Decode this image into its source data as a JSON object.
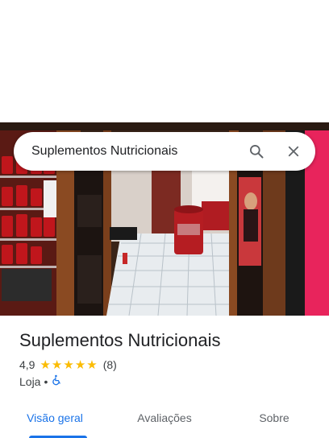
{
  "search": {
    "query": "Suplementos Nutricionais",
    "search_icon": "search-icon",
    "close_icon": "close-icon"
  },
  "place": {
    "name": "Suplementos Nutricionais",
    "rating": "4,9",
    "stars": 5,
    "review_count": "(8)",
    "category": "Loja",
    "separator": "•",
    "accessibility_icon": "wheelchair-icon"
  },
  "tabs": [
    {
      "label": "Visão geral",
      "active": true
    },
    {
      "label": "Avaliações",
      "active": false
    },
    {
      "label": "Sobre",
      "active": false
    }
  ],
  "colors": {
    "accent": "#1a73e8",
    "star": "#fbbc04"
  }
}
